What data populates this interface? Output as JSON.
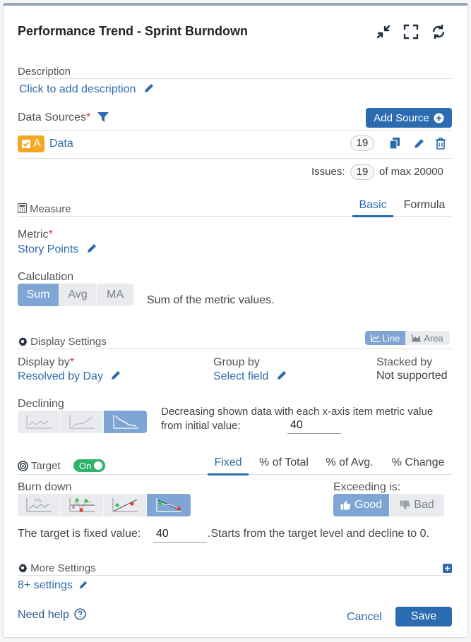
{
  "header": {
    "title": "Performance Trend - Sprint Burndown"
  },
  "description": {
    "label": "Description",
    "link": "Click to add description"
  },
  "data_sources": {
    "label": "Data Sources",
    "required_mark": "*",
    "add_button": "Add Source",
    "items": [
      {
        "badge": "A",
        "name": "Data",
        "count": "19"
      }
    ],
    "issues_label": "Issues:",
    "issues_count": "19",
    "issues_max": "of max 20000"
  },
  "measure": {
    "label": "Measure",
    "tabs": [
      {
        "label": "Basic"
      },
      {
        "label": "Formula"
      }
    ],
    "metric_label": "Metric",
    "metric_value": "Story Points",
    "calc_label": "Calculation",
    "calc_options": [
      "Sum",
      "Avg",
      "MA"
    ],
    "calc_description": "Sum of the metric values."
  },
  "display": {
    "label": "Display Settings",
    "chart_types": [
      "Line",
      "Area"
    ],
    "display_by_label": "Display by",
    "display_by_value": "Resolved by Day",
    "group_by_label": "Group by",
    "group_by_value": "Select field",
    "stacked_label": "Stacked by",
    "stacked_value": "Not supported",
    "declining_label": "Declining",
    "declining_text": "Decreasing shown data with each x-axis item metric value from initial value:",
    "declining_value": "40"
  },
  "target": {
    "label": "Target",
    "toggle": "On",
    "tabs": [
      "Fixed",
      "% of Total",
      "% of Avg.",
      "% Change"
    ],
    "burn_label": "Burn down",
    "exceeding_label": "Exceeding is:",
    "good": "Good",
    "bad": "Bad",
    "fixed_label": "The target is fixed value:",
    "fixed_value": "40",
    "fixed_suffix": ".Starts from the target level and decline to 0."
  },
  "more": {
    "label": "More Settings",
    "link": "8+ settings"
  },
  "footer": {
    "help": "Need help",
    "cancel": "Cancel",
    "save": "Save"
  }
}
